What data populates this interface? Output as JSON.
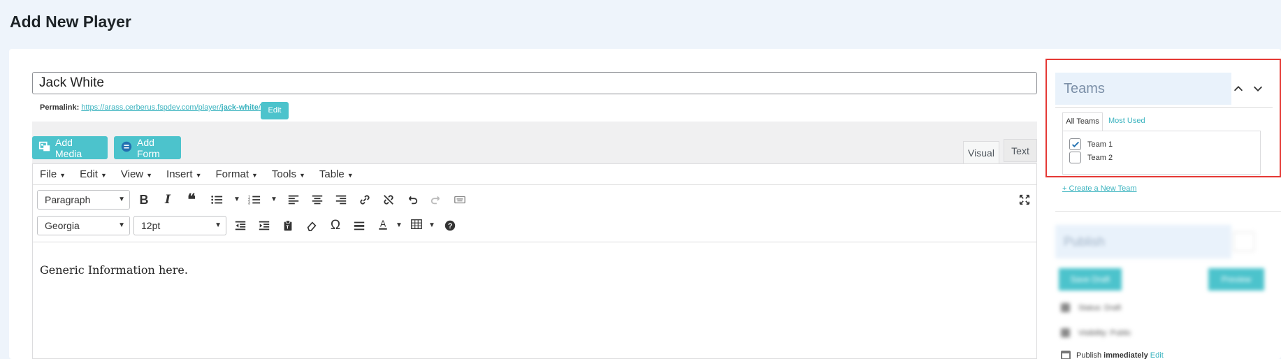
{
  "page": {
    "title": "Add New Player"
  },
  "post": {
    "title_value": "Jack White",
    "permalink_label": "Permalink:",
    "permalink_base": "https://arass.cerberus.fspdev.com/player/",
    "permalink_slug": "jack-white",
    "permalink_suffix": "/",
    "edit_label": "Edit"
  },
  "media_buttons": {
    "add_media": "Add Media",
    "add_form": "Add Form"
  },
  "editor_tabs": {
    "visual": "Visual",
    "text": "Text"
  },
  "menubar": [
    "File",
    "Edit",
    "View",
    "Insert",
    "Format",
    "Tools",
    "Table"
  ],
  "toolbar": {
    "format_select": "Paragraph",
    "font_select": "Georgia",
    "size_select": "12pt"
  },
  "content": {
    "body": "Generic Information here."
  },
  "teams": {
    "title": "Teams",
    "tab_all": "All Teams",
    "tab_most_used": "Most Used",
    "items": [
      {
        "label": "Team 1",
        "checked": true
      },
      {
        "label": "Team 2",
        "checked": false
      }
    ],
    "create_link": "+ Create a New Team"
  },
  "publish": {
    "title": "Publish",
    "save_draft": "Save Draft",
    "preview": "Preview",
    "status_row": "Status: Draft",
    "visibility_row": "Visibility: Public",
    "publish_prefix": "Publish",
    "publish_when": "immediately",
    "publish_edit": "Edit"
  },
  "colors": {
    "accent": "#4cc3cc",
    "highlight": "#e53935",
    "link": "#3ab3bf"
  }
}
